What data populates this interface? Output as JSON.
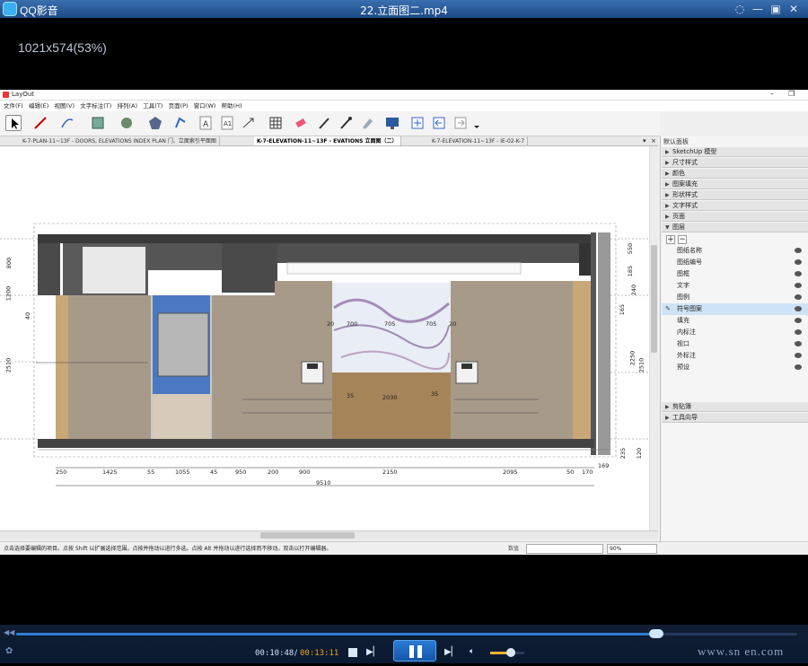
{
  "qq": {
    "app_name": "QQ影音",
    "file_name": "22.立面图二.mp4",
    "controls": [
      "◌",
      "—",
      "▣",
      "✕"
    ],
    "resolution_info": "1021x574(53%)"
  },
  "layout": {
    "app_title": "LayOut",
    "menu": [
      "文件(F)",
      "编辑(E)",
      "视图(V)",
      "文字标注(T)",
      "排列(A)",
      "工具(T)",
      "页面(P)",
      "窗口(W)",
      "帮助(H)"
    ],
    "tabs": [
      {
        "label": "K-7-PLAN-11~13F - DOORS, ELEVATIONS INDEX PLAN 门、立面索引平面图"
      },
      {
        "label": "K-7-ELEVATION-11~13F - EVATIONS 立面图（二）"
      },
      {
        "label": "K-7-ELEVATION-11~13F - IE-02-K-7"
      }
    ],
    "drawing": {
      "dims_bottom": [
        "250",
        "1425",
        "55",
        "1055",
        "45",
        "950",
        "200",
        "900",
        "2150",
        "2095",
        "50",
        "170",
        "169"
      ],
      "total": "9510",
      "dims_left": [
        "800",
        "40",
        "1200",
        "2510"
      ],
      "dims_right": [
        "550",
        "185",
        "240",
        "165",
        "2250",
        "2510",
        "235",
        "120"
      ],
      "dims_inner": [
        "700",
        "705",
        "705",
        "35",
        "2030",
        "35",
        "20",
        "20"
      ]
    },
    "tray": {
      "title": "默认面板",
      "sections_top": [
        "SketchUp 模型",
        "尺寸样式",
        "颜色",
        "图案填充",
        "形状样式",
        "文字样式",
        "页面",
        "图层"
      ],
      "layers": [
        "图纸名称",
        "图纸编号",
        "图框",
        "文字",
        "图例",
        "符号图案",
        "填充",
        "内标注",
        "视口",
        "外标注",
        "预设"
      ],
      "active_layer": "符号图案",
      "sections_bottom": [
        "剪贴簿",
        "工具向导"
      ]
    },
    "status": {
      "message": "点击选择要编辑的项目。点按 Shift 以扩展选择范围。点按并拖动以进行多选。点按 Alt 并拖动以进行选择而不移动。双击以打开编辑器。",
      "measurements_label": "数值",
      "zoom": "90%"
    }
  },
  "player": {
    "current_time": "00:10:48",
    "separator": "/",
    "total_time": "00:13:11",
    "progress": 0.82,
    "volume": 0.6,
    "watermark": "www.sn en.com"
  }
}
